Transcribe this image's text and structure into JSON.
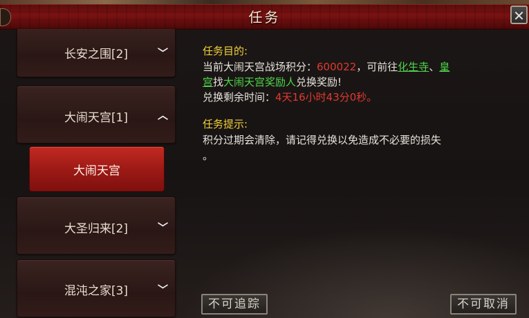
{
  "window": {
    "title": "任务",
    "close_label": "✕"
  },
  "quest_list": {
    "items": [
      {
        "label": "长安之围[2]",
        "expanded": false
      },
      {
        "label": "大闹天宫[1]",
        "expanded": true
      },
      {
        "label": "大圣归来[2]",
        "expanded": false
      },
      {
        "label": "混沌之家[3]",
        "expanded": false
      }
    ],
    "selected_sub": "大闹天宫"
  },
  "objective": {
    "heading": "任务目的:",
    "line1_prefix": "当前大闹天宫战场积分：",
    "score": "600022",
    "line1_mid": "，可前往",
    "link1": "化生寺",
    "sep": "、",
    "link2_part1": "皇",
    "link2_part2": "宫",
    "line2_find": "找",
    "npc": "大闹天宫奖励人",
    "line2_suffix": "兑换奖励!",
    "time_prefix": "兑换剩余时间：",
    "time_value": "4天16小时43分0秒。"
  },
  "hint": {
    "heading": "任务提示:",
    "text": "积分过期会清除，请记得兑换以免造成不必要的损失",
    "text_end": "。"
  },
  "buttons": {
    "track": "不可追踪",
    "cancel": "不可取消"
  },
  "colors": {
    "heading": "#f2d03a",
    "highlight_red": "#e03a30",
    "highlight_green": "#4ed64a",
    "selected_bg": "#b0211b"
  }
}
